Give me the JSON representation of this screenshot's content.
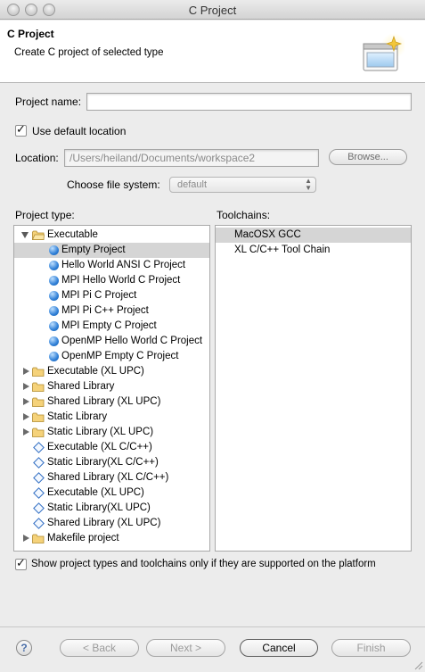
{
  "window": {
    "title": "C Project"
  },
  "banner": {
    "title": "C Project",
    "subtitle": "Create C project of selected type"
  },
  "form": {
    "project_name_label": "Project name:",
    "project_name_value": "",
    "use_default_location_label": "Use default location",
    "use_default_location_checked": true,
    "location_label": "Location:",
    "location_value": "/Users/heiland/Documents/workspace2",
    "browse_label": "Browse...",
    "file_system_label": "Choose file system:",
    "file_system_value": "default"
  },
  "project_type": {
    "header": "Project type:",
    "items": [
      {
        "label": "Executable",
        "icon": "folder-icon",
        "expander": "expanded",
        "level": 0
      },
      {
        "label": "Empty Project",
        "icon": "bullet-icon",
        "level": 1,
        "selected": true
      },
      {
        "label": "Hello World ANSI C Project",
        "icon": "bullet-icon",
        "level": 1
      },
      {
        "label": "MPI Hello World C Project",
        "icon": "bullet-icon",
        "level": 1
      },
      {
        "label": "MPI Pi C Project",
        "icon": "bullet-icon",
        "level": 1
      },
      {
        "label": "MPI Pi C++ Project",
        "icon": "bullet-icon",
        "level": 1
      },
      {
        "label": "MPI Empty C Project",
        "icon": "bullet-icon",
        "level": 1
      },
      {
        "label": "OpenMP Hello World C Project",
        "icon": "bullet-icon",
        "level": 1
      },
      {
        "label": "OpenMP Empty C Project",
        "icon": "bullet-icon",
        "level": 1
      },
      {
        "label": "Executable (XL UPC)",
        "icon": "folder-icon",
        "expander": "collapsed",
        "level": 0
      },
      {
        "label": "Shared Library",
        "icon": "folder-icon",
        "expander": "collapsed",
        "level": 0
      },
      {
        "label": "Shared Library (XL UPC)",
        "icon": "folder-icon",
        "expander": "collapsed",
        "level": 0
      },
      {
        "label": "Static Library",
        "icon": "folder-icon",
        "expander": "collapsed",
        "level": 0
      },
      {
        "label": "Static Library (XL UPC)",
        "icon": "folder-icon",
        "expander": "collapsed",
        "level": 0
      },
      {
        "label": "Executable (XL C/C++)",
        "icon": "diamond-icon",
        "level": 0
      },
      {
        "label": "Static Library(XL C/C++)",
        "icon": "diamond-icon",
        "level": 0
      },
      {
        "label": "Shared Library (XL C/C++)",
        "icon": "diamond-icon",
        "level": 0
      },
      {
        "label": "Executable (XL UPC)",
        "icon": "diamond-icon",
        "level": 0
      },
      {
        "label": "Static Library(XL UPC)",
        "icon": "diamond-icon",
        "level": 0
      },
      {
        "label": "Shared Library (XL UPC)",
        "icon": "diamond-icon",
        "level": 0
      },
      {
        "label": "Makefile project",
        "icon": "folder-icon",
        "expander": "collapsed",
        "level": 0
      }
    ]
  },
  "toolchains": {
    "header": "Toolchains:",
    "items": [
      {
        "label": "MacOSX GCC",
        "selected": true
      },
      {
        "label": "XL C/C++ Tool Chain"
      }
    ]
  },
  "filter": {
    "label": "Show project types and toolchains only if they are supported on the platform",
    "checked": true
  },
  "buttons": {
    "help": "?",
    "back": "< Back",
    "next": "Next >",
    "cancel": "Cancel",
    "finish": "Finish"
  }
}
